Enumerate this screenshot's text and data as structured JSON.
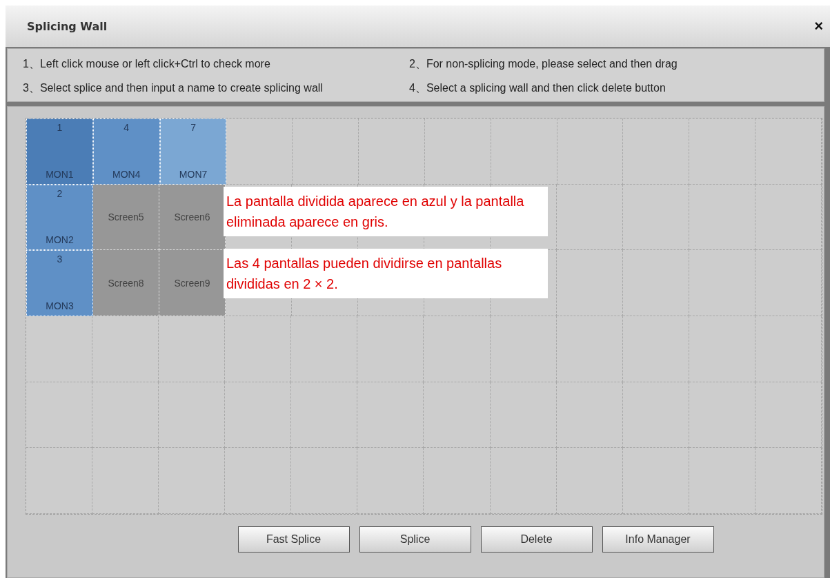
{
  "window": {
    "title": "Splicing Wall",
    "close": "×"
  },
  "instructions": [
    "1、Left click mouse or left click+Ctrl to check more",
    "2、For non-splicing mode, please select and then drag",
    "3、Select splice and then input a name to create splicing wall",
    "4、Select a splicing wall and then click delete button"
  ],
  "grid": {
    "rows": [
      {
        "cells": [
          {
            "kind": "monitor",
            "number": "1",
            "label": "MON1",
            "color": "#4b7db6"
          },
          {
            "kind": "monitor",
            "number": "4",
            "label": "MON4",
            "color": "#5f90c6"
          },
          {
            "kind": "monitor",
            "number": "7",
            "label": "MON7",
            "color": "#7ba7d3"
          },
          {
            "kind": "empty"
          },
          {
            "kind": "empty"
          },
          {
            "kind": "empty"
          },
          {
            "kind": "empty"
          },
          {
            "kind": "empty"
          },
          {
            "kind": "empty"
          },
          {
            "kind": "empty"
          },
          {
            "kind": "empty"
          },
          {
            "kind": "empty"
          }
        ]
      },
      {
        "cells": [
          {
            "kind": "monitor",
            "number": "2",
            "label": "MON2",
            "color": "#5f90c6"
          },
          {
            "kind": "screen",
            "label": "Screen5"
          },
          {
            "kind": "screen",
            "label": "Screen6"
          },
          {
            "kind": "empty"
          },
          {
            "kind": "empty"
          },
          {
            "kind": "empty"
          },
          {
            "kind": "empty"
          },
          {
            "kind": "empty"
          },
          {
            "kind": "empty"
          },
          {
            "kind": "empty"
          },
          {
            "kind": "empty"
          },
          {
            "kind": "empty"
          }
        ]
      },
      {
        "cells": [
          {
            "kind": "monitor",
            "number": "3",
            "label": "MON3",
            "color": "#5f90c6"
          },
          {
            "kind": "screen",
            "label": "Screen8"
          },
          {
            "kind": "screen",
            "label": "Screen9"
          },
          {
            "kind": "empty"
          },
          {
            "kind": "empty"
          },
          {
            "kind": "empty"
          },
          {
            "kind": "empty"
          },
          {
            "kind": "empty"
          },
          {
            "kind": "empty"
          },
          {
            "kind": "empty"
          },
          {
            "kind": "empty"
          },
          {
            "kind": "empty"
          }
        ]
      },
      {
        "cells": [
          {
            "kind": "empty"
          },
          {
            "kind": "empty"
          },
          {
            "kind": "empty"
          },
          {
            "kind": "empty"
          },
          {
            "kind": "empty"
          },
          {
            "kind": "empty"
          },
          {
            "kind": "empty"
          },
          {
            "kind": "empty"
          },
          {
            "kind": "empty"
          },
          {
            "kind": "empty"
          },
          {
            "kind": "empty"
          },
          {
            "kind": "empty"
          }
        ]
      },
      {
        "cells": [
          {
            "kind": "empty"
          },
          {
            "kind": "empty"
          },
          {
            "kind": "empty"
          },
          {
            "kind": "empty"
          },
          {
            "kind": "empty"
          },
          {
            "kind": "empty"
          },
          {
            "kind": "empty"
          },
          {
            "kind": "empty"
          },
          {
            "kind": "empty"
          },
          {
            "kind": "empty"
          },
          {
            "kind": "empty"
          },
          {
            "kind": "empty"
          }
        ]
      },
      {
        "cells": [
          {
            "kind": "empty"
          },
          {
            "kind": "empty"
          },
          {
            "kind": "empty"
          },
          {
            "kind": "empty"
          },
          {
            "kind": "empty"
          },
          {
            "kind": "empty"
          },
          {
            "kind": "empty"
          },
          {
            "kind": "empty"
          },
          {
            "kind": "empty"
          },
          {
            "kind": "empty"
          },
          {
            "kind": "empty"
          },
          {
            "kind": "empty"
          }
        ]
      }
    ]
  },
  "notes": [
    "La pantalla dividida aparece en azul y la pantalla eliminada aparece en gris.",
    "Las 4 pantallas pueden dividirse en pantallas divididas en 2 × 2."
  ],
  "buttons": [
    "Fast Splice",
    "Splice",
    "Delete",
    "Info Manager"
  ]
}
